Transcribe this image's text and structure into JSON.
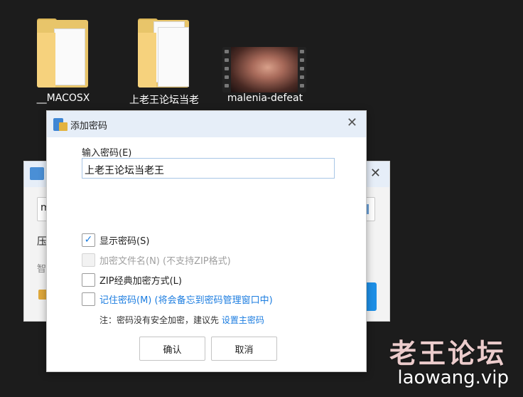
{
  "desktop": {
    "icons": [
      {
        "name": "__MACOSX"
      },
      {
        "name": "上老王论坛当老"
      },
      {
        "name": "malenia-defeat"
      }
    ]
  },
  "background_window": {
    "path_value": "m",
    "label_1": "压",
    "label_2": "智"
  },
  "dialog": {
    "title": "添加密码",
    "close_glyph": "✕",
    "password_label": "输入密码(E)",
    "password_value": "上老王论坛当老王",
    "options": [
      {
        "label": "显示密码(S)",
        "checked": true,
        "disabled": false
      },
      {
        "label": "加密文件名(N) (不支持ZIP格式)",
        "checked": false,
        "disabled": true
      },
      {
        "label": "ZIP经典加密方式(L)",
        "checked": false,
        "disabled": false
      },
      {
        "label": "记住密码(M) (将会备忘到密码管理窗口中)",
        "checked": false,
        "disabled": false
      }
    ],
    "note_text": "注：密码没有安全加密，建议先 ",
    "note_link": "设置主密码",
    "ok_label": "确认",
    "cancel_label": "取消"
  },
  "watermark": {
    "line1": "老王论坛",
    "line2": "laowang.vip"
  },
  "colors": {
    "accent": "#1c7de0",
    "title_bar": "#e6eef8",
    "desktop_bg": "#1c1c1c"
  }
}
